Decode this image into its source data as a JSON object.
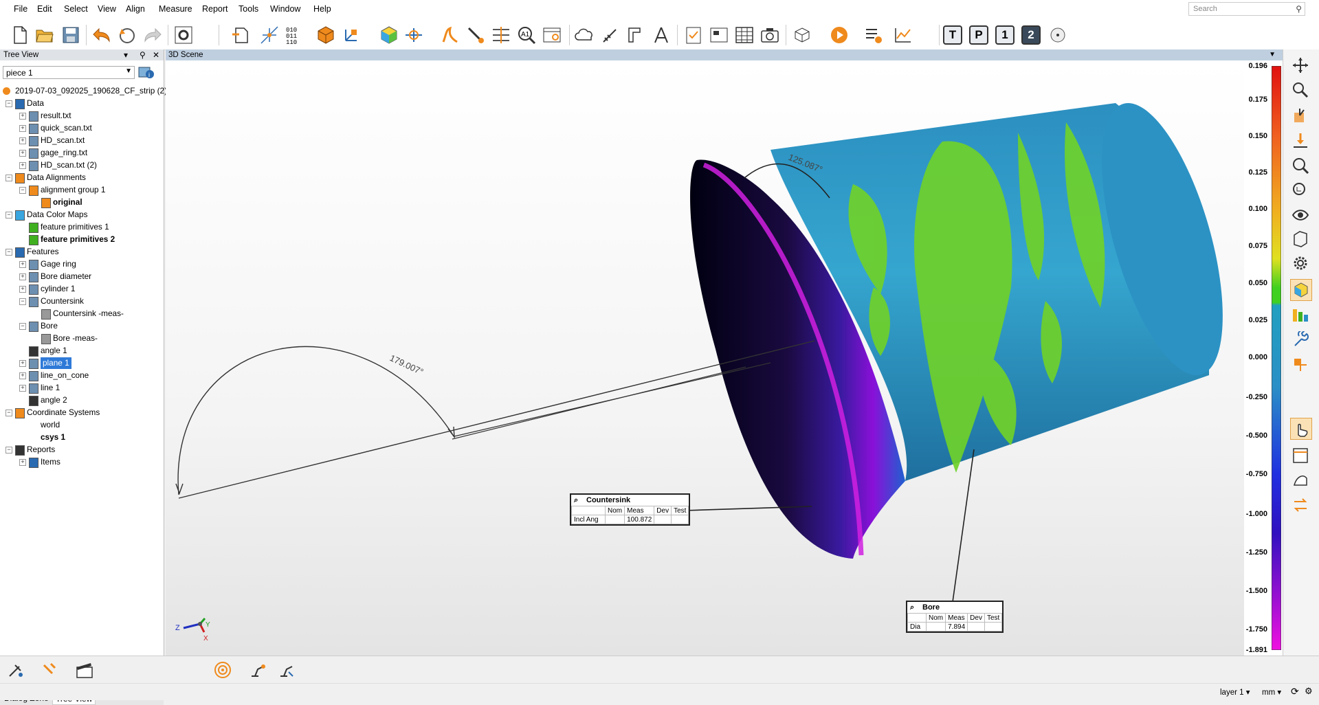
{
  "menu": [
    "File",
    "Edit",
    "Select",
    "View",
    "Align",
    "Measure",
    "Report",
    "Tools",
    "Window",
    "Help"
  ],
  "search": {
    "placeholder": "Search"
  },
  "toolbar": {
    "letters": [
      "T",
      "P",
      "1",
      "2"
    ]
  },
  "tree_panel": {
    "title": "Tree View",
    "combo_value": "piece 1"
  },
  "tree": {
    "root": "2019-07-03_092025_190628_CF_strip (2) -",
    "items": [
      {
        "label": "Data",
        "bold": false
      },
      {
        "label": "result.txt",
        "bold": false
      },
      {
        "label": "quick_scan.txt",
        "bold": false
      },
      {
        "label": "HD_scan.txt",
        "bold": false
      },
      {
        "label": "gage_ring.txt",
        "bold": false
      },
      {
        "label": "HD_scan.txt (2)",
        "bold": false
      },
      {
        "label": "Data Alignments",
        "bold": false
      },
      {
        "label": "alignment group 1",
        "bold": false
      },
      {
        "label": "original",
        "bold": true
      },
      {
        "label": "Data Color Maps",
        "bold": false
      },
      {
        "label": "feature primitives 1",
        "bold": false
      },
      {
        "label": "feature primitives 2",
        "bold": true
      },
      {
        "label": "Features",
        "bold": false
      },
      {
        "label": "Gage ring",
        "bold": false
      },
      {
        "label": "Bore diameter",
        "bold": false
      },
      {
        "label": "cylinder 1",
        "bold": false
      },
      {
        "label": "Countersink",
        "bold": false
      },
      {
        "label": "Countersink -meas-",
        "bold": false
      },
      {
        "label": "Bore",
        "bold": false
      },
      {
        "label": "Bore -meas-",
        "bold": false
      },
      {
        "label": "angle 1",
        "bold": false
      },
      {
        "label": "plane 1",
        "bold": false
      },
      {
        "label": "line_on_cone",
        "bold": false
      },
      {
        "label": "line 1",
        "bold": false
      },
      {
        "label": "angle 2",
        "bold": false
      },
      {
        "label": "Coordinate Systems",
        "bold": false
      },
      {
        "label": "world",
        "bold": false
      },
      {
        "label": "csys 1",
        "bold": true
      },
      {
        "label": "Reports",
        "bold": false
      },
      {
        "label": "Items",
        "bold": false
      }
    ]
  },
  "bottom_tabs": [
    "Dialog Zone",
    "Tree View"
  ],
  "scene": {
    "title": "3D Scene",
    "angle_large": "179.007°",
    "angle_small": "125.087°",
    "axes": {
      "z": "Z",
      "y": "Y",
      "x": "X"
    }
  },
  "callouts": {
    "countersink": {
      "title": "Countersink",
      "headers": [
        "",
        "Nom",
        "Meas",
        "Dev",
        "Test"
      ],
      "row": [
        "Incl Ang",
        "",
        "100.872",
        "",
        ""
      ]
    },
    "bore": {
      "title": "Bore",
      "headers": [
        "",
        "Nom",
        "Meas",
        "Dev",
        "Test"
      ],
      "row": [
        "Dia",
        "",
        "7.894",
        "",
        ""
      ]
    }
  },
  "colorbar": {
    "labels": [
      "0.196",
      "0.175",
      "0.150",
      "0.125",
      "0.100",
      "0.075",
      "0.050",
      "0.025",
      "0.000",
      "-0.250",
      "-0.500",
      "-0.750",
      "-1.000",
      "-1.250",
      "-1.500",
      "-1.750",
      "-1.891"
    ]
  },
  "status": {
    "layer": "layer 1",
    "units": "mm"
  }
}
